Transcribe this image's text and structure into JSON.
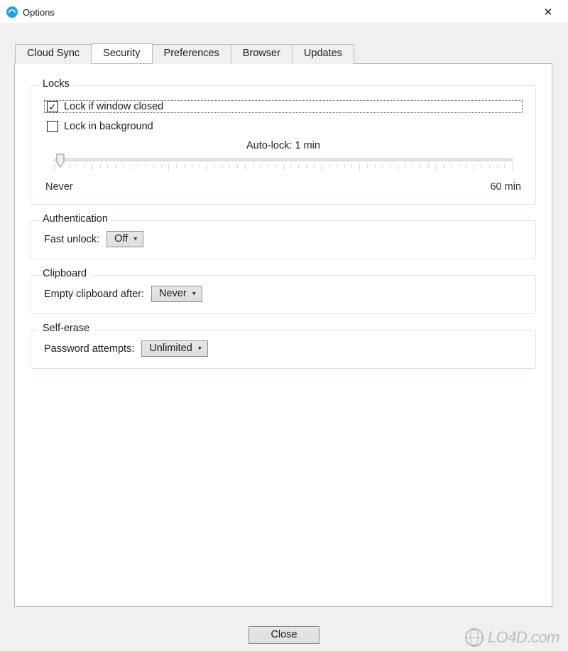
{
  "window": {
    "title": "Options",
    "close_icon": "✕"
  },
  "tabs": [
    {
      "label": "Cloud Sync",
      "active": false
    },
    {
      "label": "Security",
      "active": true
    },
    {
      "label": "Preferences",
      "active": false
    },
    {
      "label": "Browser",
      "active": false
    },
    {
      "label": "Updates",
      "active": false
    }
  ],
  "locks": {
    "legend": "Locks",
    "check_window_closed": {
      "label": "Lock if window closed",
      "checked": true
    },
    "check_background": {
      "label": "Lock in background",
      "checked": false
    },
    "autolock_label": "Auto-lock: 1 min",
    "slider": {
      "min_label": "Never",
      "max_label": "60 min",
      "value": 1,
      "max": 60
    }
  },
  "auth": {
    "legend": "Authentication",
    "fast_unlock_label": "Fast unlock:",
    "fast_unlock_value": "Off"
  },
  "clipboard": {
    "legend": "Clipboard",
    "empty_after_label": "Empty clipboard after:",
    "empty_after_value": "Never"
  },
  "self_erase": {
    "legend": "Self-erase",
    "attempts_label": "Password attempts:",
    "attempts_value": "Unlimited"
  },
  "footer": {
    "close_label": "Close"
  },
  "watermark": {
    "text": "LO4D.com"
  }
}
